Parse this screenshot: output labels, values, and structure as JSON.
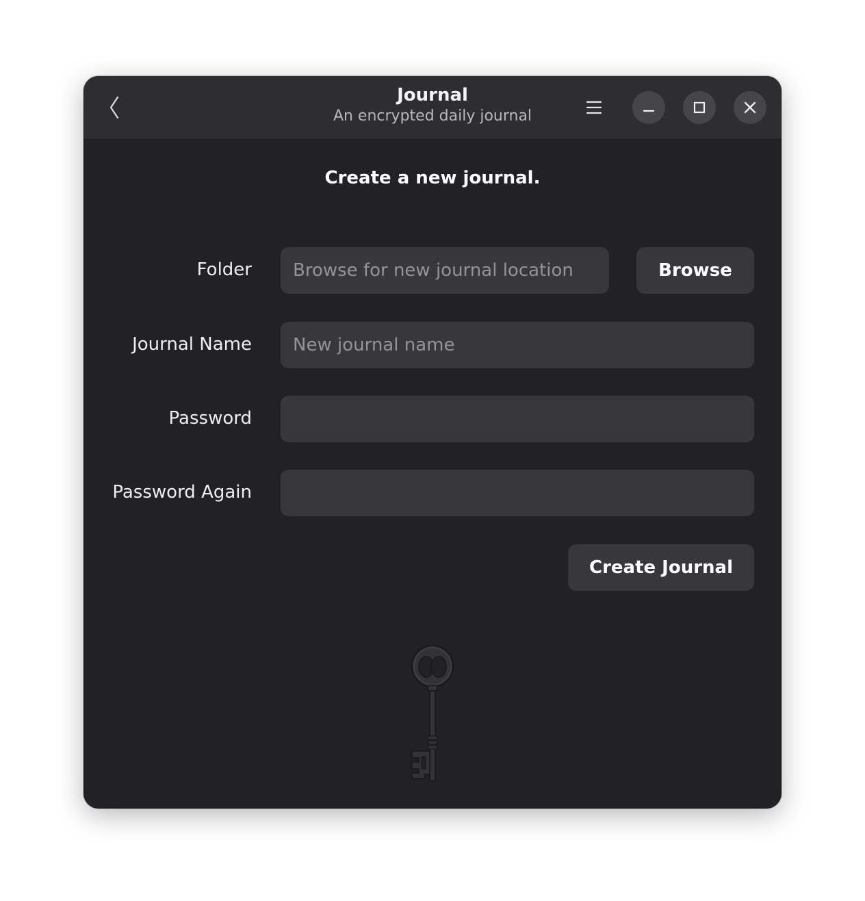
{
  "header": {
    "title": "Journal",
    "subtitle": "An encrypted daily journal",
    "back_icon": "chevron-left-icon",
    "menu_icon": "hamburger-menu-icon",
    "minimize_icon": "minimize-icon",
    "maximize_icon": "maximize-icon",
    "close_icon": "close-icon"
  },
  "form": {
    "heading": "Create a new journal.",
    "folder": {
      "label": "Folder",
      "placeholder": "Browse for new journal location",
      "value": ""
    },
    "browse_label": "Browse",
    "journal_name": {
      "label": "Journal Name",
      "placeholder": "New journal name",
      "value": ""
    },
    "password": {
      "label": "Password",
      "value": ""
    },
    "password_again": {
      "label": "Password Again",
      "value": ""
    },
    "create_label": "Create Journal"
  },
  "illustration": {
    "icon": "key-icon"
  },
  "colors": {
    "window_bg": "#222226",
    "header_bg": "#2e2e32",
    "entry_bg": "#38383c",
    "window_control_bg": "#45454a",
    "text": "#eeeeee",
    "placeholder": "#949497"
  }
}
